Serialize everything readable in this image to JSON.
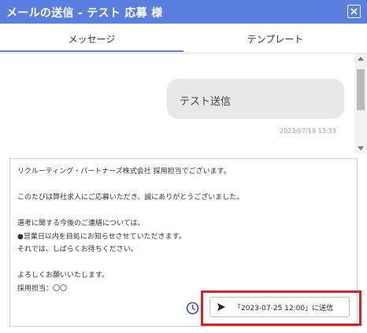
{
  "dialog": {
    "title": "メールの送信 - テスト 応募 様"
  },
  "tabs": [
    {
      "label": "メッセージ",
      "active": true
    },
    {
      "label": "テンプレート",
      "active": false
    }
  ],
  "chat": {
    "messages": [
      {
        "text": "テスト送信",
        "timestamp": "2023/07/19 13:33"
      }
    ]
  },
  "composer": {
    "body": "リクルーティング・パートナーズ株式会社 採用担当でございます。\n\nこのたびは弊社求人にご応募いただき、誠にありがとうございました。\n\n選考に関する今後のご連絡については、\n●営業日以内を目処にお知らせさせていただきます。\nそれでは、しばらくお待ちください。\n\nよろしくお願いいたします。\n採用担当：〇〇"
  },
  "actions": {
    "scheduled_send_label": "「2023-07-25 12:00」に送信"
  },
  "colors": {
    "header": "#5b7fe0",
    "highlight": "#e02020",
    "clock": "#3a4fa8"
  },
  "icons": {
    "close": "close-icon",
    "clock": "clock-icon",
    "send": "send-icon"
  }
}
